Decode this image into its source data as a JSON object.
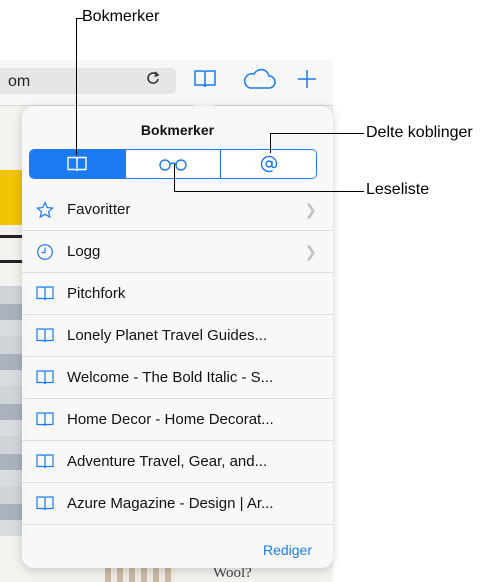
{
  "callouts": {
    "bookmarks": "Bokmerker",
    "shared_links": "Delte koblinger",
    "reading_list": "Leseliste"
  },
  "browser": {
    "url_fragment": "om",
    "reload_icon": "reload-icon",
    "bookmarks_icon": "book-icon",
    "icloud_icon": "cloud-icon",
    "new_tab_icon": "plus-icon"
  },
  "background_page": {
    "text_fragment": "Wool?"
  },
  "popover": {
    "title": "Bokmerker",
    "tabs": [
      {
        "icon": "book-icon",
        "name": "bookmarks",
        "active": true
      },
      {
        "icon": "glasses-icon",
        "name": "reading-list",
        "active": false
      },
      {
        "icon": "at-icon",
        "name": "shared-links",
        "active": false
      }
    ],
    "items": [
      {
        "label": "Favoritter",
        "icon": "star-icon",
        "chevron": true
      },
      {
        "label": "Logg",
        "icon": "clock-icon",
        "chevron": true
      },
      {
        "label": "Pitchfork",
        "icon": "book-icon",
        "chevron": false
      },
      {
        "label": "Lonely Planet Travel Guides...",
        "icon": "book-icon",
        "chevron": false
      },
      {
        "label": "Welcome - The Bold Italic - S...",
        "icon": "book-icon",
        "chevron": false
      },
      {
        "label": "Home Decor - Home Decorat...",
        "icon": "book-icon",
        "chevron": false
      },
      {
        "label": "Adventure Travel, Gear, and...",
        "icon": "book-icon",
        "chevron": false
      },
      {
        "label": "Azure Magazine - Design | Ar...",
        "icon": "book-icon",
        "chevron": false
      }
    ],
    "edit_label": "Rediger"
  },
  "colors": {
    "accent": "#1a7bf2",
    "separator": "#dedede"
  }
}
